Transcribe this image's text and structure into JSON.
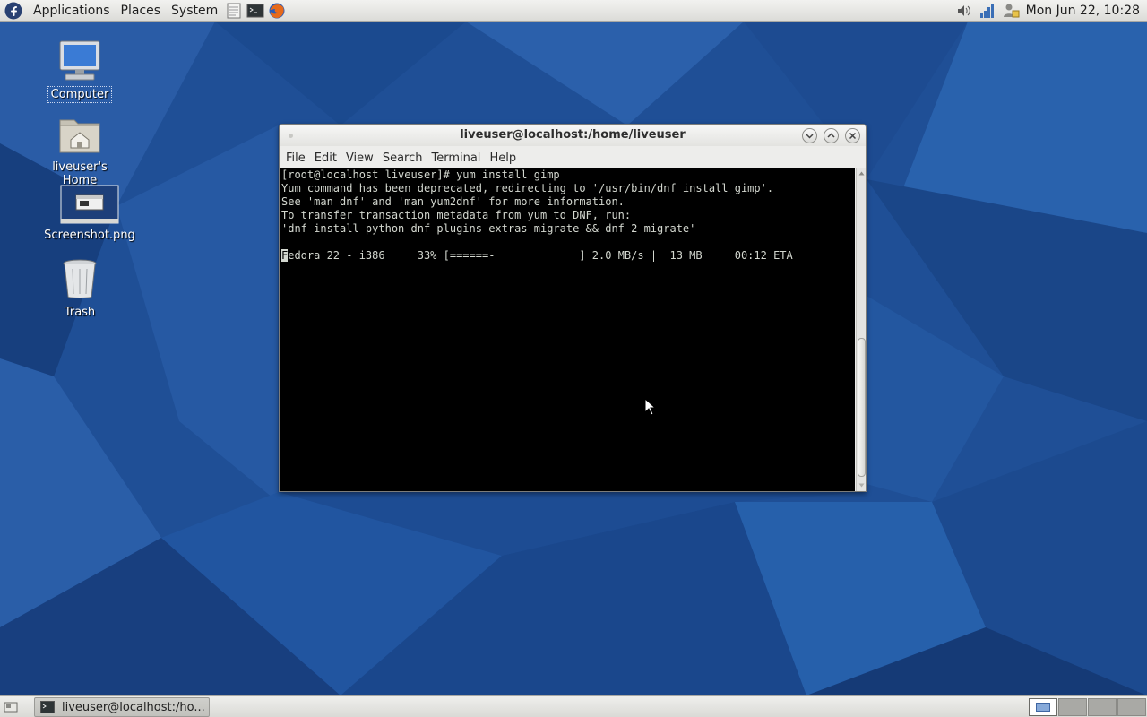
{
  "top_panel": {
    "menus": [
      "Applications",
      "Places",
      "System"
    ],
    "launchers": [
      "text-editor-icon",
      "terminal-icon",
      "firefox-icon"
    ],
    "tray": [
      "volume-icon",
      "network-signal-icon",
      "user-switch-icon"
    ],
    "clock": "Mon Jun 22, 10:28"
  },
  "desktop": {
    "icons": [
      {
        "label": "Computer",
        "icon": "computer-icon",
        "selected": true
      },
      {
        "label": "liveuser's Home",
        "icon": "home-folder-icon"
      },
      {
        "label": "Screenshot.png",
        "icon": "image-file-icon"
      },
      {
        "label": "Trash",
        "icon": "trash-icon"
      }
    ]
  },
  "terminal": {
    "title": "liveuser@localhost:/home/liveuser",
    "menu": [
      "File",
      "Edit",
      "View",
      "Search",
      "Terminal",
      "Help"
    ],
    "lines": [
      "[root@localhost liveuser]# yum install gimp",
      "Yum command has been deprecated, redirecting to '/usr/bin/dnf install gimp'.",
      "See 'man dnf' and 'man yum2dnf' for more information.",
      "To transfer transaction metadata from yum to DNF, run:",
      "'dnf install python-dnf-plugins-extras-migrate && dnf-2 migrate'",
      ""
    ],
    "progress": {
      "cursor_char": "F",
      "text_rest": "edora 22 - i386     33% [======-             ] 2.0 MB/s |  13 MB     00:12 ETA"
    }
  },
  "taskbar": {
    "task_label": "liveuser@localhost:/ho...",
    "workspaces": 4,
    "active_workspace": 1
  },
  "colors": {
    "desktop": "#1f4f96",
    "terminal_bg": "#000000",
    "terminal_fg": "#d3d7cf"
  }
}
